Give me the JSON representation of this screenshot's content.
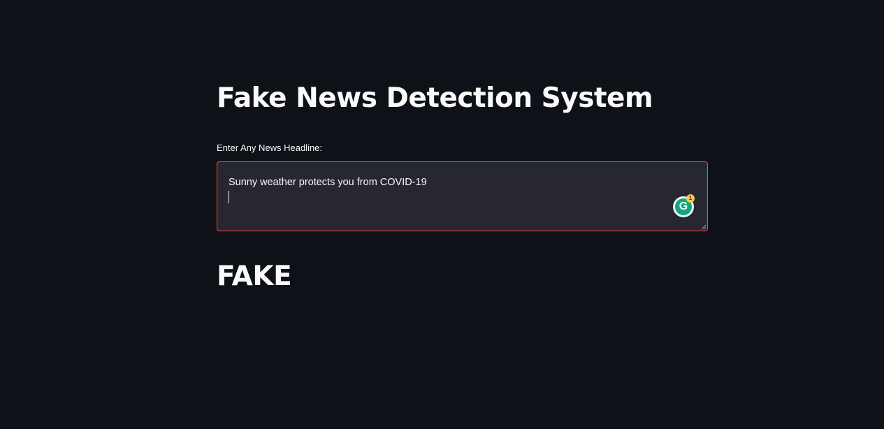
{
  "page": {
    "title": "Fake News Detection System"
  },
  "input": {
    "label": "Enter Any News Headline:",
    "value": "Sunny weather protects you from COVID-19"
  },
  "grammarly": {
    "letter": "G",
    "badge_count": "1"
  },
  "result": {
    "text": "FAKE"
  },
  "colors": {
    "background": "#0e1117",
    "input_background": "#262730",
    "focus_border": "#ff4b4b",
    "text": "#fafafa"
  }
}
